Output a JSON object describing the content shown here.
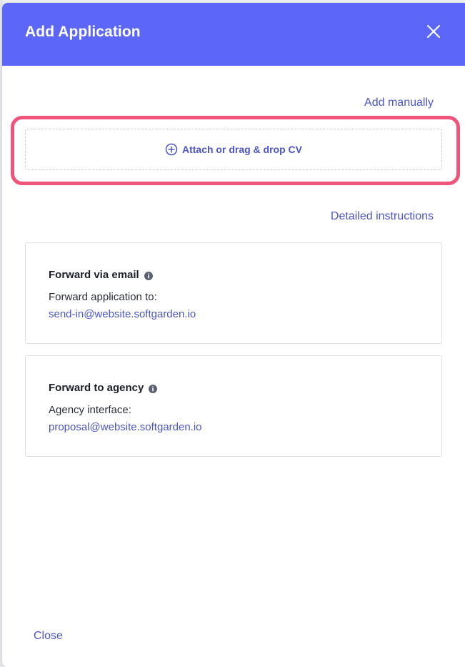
{
  "dialog": {
    "title": "Add Application",
    "close_icon": "close-icon"
  },
  "actions": {
    "add_manually": "Add manually",
    "detailed_instructions": "Detailed instructions"
  },
  "dropzone": {
    "icon": "plus-circle-icon",
    "label": "Attach or drag & drop CV"
  },
  "cards": [
    {
      "title": "Forward via email",
      "icon": "info-icon",
      "label": "Forward application to:",
      "value": "send-in@website.softgarden.io"
    },
    {
      "title": "Forward to agency",
      "icon": "info-icon",
      "label": "Agency interface:",
      "value": "proposal@website.softgarden.io"
    }
  ],
  "footer": {
    "close_label": "Close"
  },
  "colors": {
    "header": "#5c67f9",
    "link": "#4b55c8",
    "highlight": "#f0547a"
  }
}
